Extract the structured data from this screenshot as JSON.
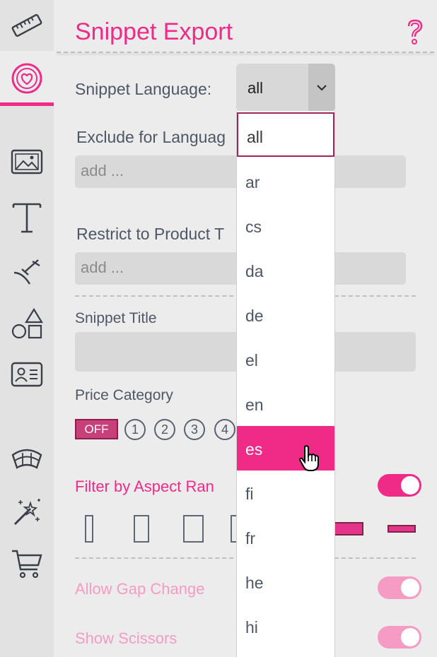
{
  "sidebar": {
    "items": [
      {
        "icon": "ruler-icon"
      },
      {
        "icon": "heart-circle-icon",
        "active": true
      },
      {
        "icon": "image-icon"
      },
      {
        "icon": "text-icon"
      },
      {
        "icon": "pickaxe-icon"
      },
      {
        "icon": "shapes-icon"
      },
      {
        "icon": "id-card-icon"
      },
      {
        "icon": "fan-icon"
      },
      {
        "icon": "magic-wand-icon"
      },
      {
        "icon": "cart-icon"
      }
    ],
    "accent": "#f02a87"
  },
  "header": {
    "title": "Snippet Export",
    "help_icon": "help-icon"
  },
  "snippet_language": {
    "label": "Snippet Language:",
    "value": "all"
  },
  "exclude": {
    "label": "Exclude for Languag",
    "placeholder": "add ..."
  },
  "restrict": {
    "label": "Restrict to Product T",
    "placeholder": "add ..."
  },
  "snippet_title": {
    "label": "Snippet Title",
    "value": ""
  },
  "price": {
    "label": "Price Category",
    "off_label": "OFF",
    "levels": [
      "1",
      "2",
      "3",
      "4"
    ]
  },
  "aspect": {
    "label": "Filter by Aspect Ran",
    "enabled": true
  },
  "gap": {
    "label": "Allow Gap Change",
    "enabled": true
  },
  "scissors": {
    "label": "Show Scissors",
    "enabled": true
  },
  "dropdown": {
    "options": [
      "all",
      "ar",
      "cs",
      "da",
      "de",
      "el",
      "en",
      "es",
      "fi",
      "fr",
      "he",
      "hi"
    ],
    "highlighted": "es"
  },
  "colors": {
    "accent": "#f02a87",
    "accent_light": "#f59bc4",
    "background": "#ececec"
  }
}
